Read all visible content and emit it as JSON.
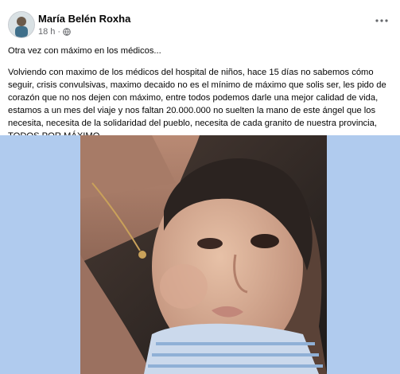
{
  "post": {
    "author": "María Belén Roxha",
    "time": "18 h",
    "separator": "·",
    "more_icon": "more-horizontal-icon",
    "privacy_icon": "globe-icon",
    "title": "Otra vez con máximo en los médicos...",
    "body_lines": [
      "Volviendo con maximo de los médicos del hospital de niños, hace 15 días no sabemos cómo",
      "seguir, crisis convulsivas, maximo decaido no es el mínimo de máximo que solis ser, les pido de",
      "corazón que no nos dejen con máximo, entre todos podemos darle una mejor calidad de vida,",
      "estamos a un mes del viaje y nos faltan 20.000.000 no suelten la mano de este ángel que los",
      "necesita, necesita de la solidaridad del pueblo, necesita de cada granito de nuestra provincia,",
      "TODOS POR MÁXIMO"
    ]
  },
  "colors": {
    "background": "#ffffff",
    "media_backdrop": "#b0cbee",
    "secondary_text": "#65676b"
  }
}
